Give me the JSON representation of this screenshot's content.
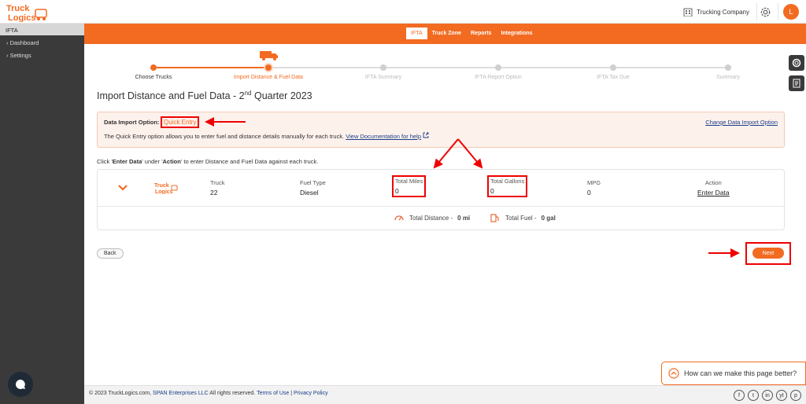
{
  "header": {
    "logo_line1": "Truck",
    "logo_line2": "Logics",
    "company": "Trucking Company",
    "avatar_letter": "L"
  },
  "sidebar": {
    "title": "IFTA",
    "items": [
      {
        "label": "Dashboard"
      },
      {
        "label": "Settings"
      }
    ]
  },
  "nav": {
    "tabs": [
      {
        "label": "IFTA",
        "active": true
      },
      {
        "label": "Truck Zone"
      },
      {
        "label": "Reports"
      },
      {
        "label": "Integrations"
      }
    ]
  },
  "steps": [
    {
      "label": "Choose Trucks",
      "state": "done"
    },
    {
      "label": "Import Distance & Fuel Data",
      "state": "current"
    },
    {
      "label": "IFTA Summary",
      "state": "pending"
    },
    {
      "label": "IFTA Report Option",
      "state": "pending"
    },
    {
      "label": "IFTA Tax Due",
      "state": "pending"
    },
    {
      "label": "Summary",
      "state": "pending"
    }
  ],
  "page": {
    "title_pre": "Import Distance and Fuel Data - 2",
    "title_sup": "nd",
    "title_post": " Quarter 2023"
  },
  "notice": {
    "label": "Data Import Option:",
    "value": "Quick Entry",
    "change": "Change Data Import Option",
    "desc": "The Quick Entry option allows you to enter fuel and distance details manually for each truck.",
    "doc_link": "View Documentation for help"
  },
  "hint": {
    "pre": "Click '",
    "b1": "Enter Data",
    "mid": "' under '",
    "b2": "Action",
    "post": "' to enter Distance and Fuel Data against each truck."
  },
  "table": {
    "truck_h": "Truck",
    "truck_v": "22",
    "fuel_h": "Fuel Type",
    "fuel_v": "Diesel",
    "miles_h": "Total Miles",
    "miles_v": "0",
    "gallons_h": "Total Gallons",
    "gallons_v": "0",
    "mpg_h": "MPG",
    "mpg_v": "0",
    "action_h": "Action",
    "action_v": "Enter Data",
    "total_distance_label": "Total Distance - ",
    "total_distance_value": "0 mi",
    "total_fuel_label": "Total Fuel - ",
    "total_fuel_value": "0 gal"
  },
  "buttons": {
    "back": "Back",
    "next": "Next"
  },
  "feedback": "How can we make this page better?",
  "footer": {
    "copy_pre": "© 2023 TruckLogics.com, ",
    "span": "SPAN Enterprises LLC",
    "copy_mid": " All rights reserved. ",
    "terms": "Terms of Use",
    "sep": " | ",
    "privacy": "Privacy Policy"
  },
  "socials": [
    "f",
    "t",
    "in",
    "yt",
    "p"
  ],
  "colors": {
    "accent": "#f26b21",
    "sidebar": "#3a3a3a",
    "highlight": "#ee0000"
  }
}
